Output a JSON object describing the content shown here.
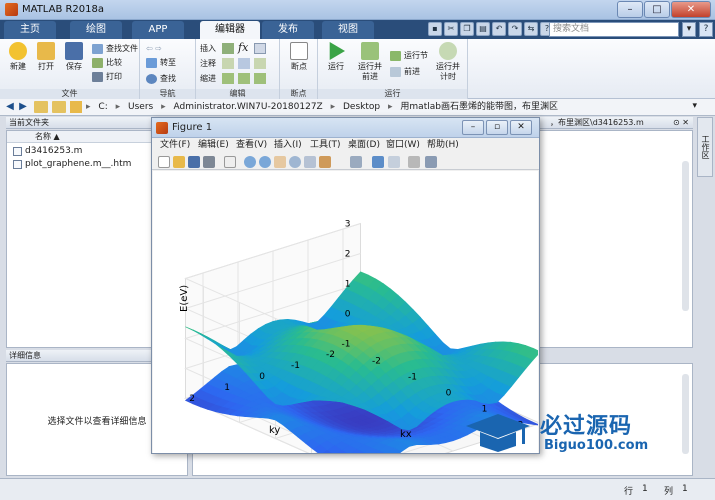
{
  "window": {
    "title": "MATLAB R2018a",
    "min": "–",
    "max": "□",
    "close": "✕"
  },
  "tabs": [
    {
      "label": "主页"
    },
    {
      "label": "绘图"
    },
    {
      "label": "APP"
    },
    {
      "label": "编辑器"
    },
    {
      "label": "发布"
    },
    {
      "label": "视图"
    }
  ],
  "active_tab": "编辑器",
  "search": {
    "placeholder": "搜索文档",
    "go": "▾",
    "help": "?"
  },
  "ribbon": {
    "file": {
      "label": "文件",
      "new": "新建",
      "open": "打开",
      "save": "保存",
      "find_files": "查找文件",
      "compare": "比较",
      "print": "打印"
    },
    "navigate": {
      "label": "导航",
      "goto": "转至",
      "find": "查找"
    },
    "edit": {
      "label": "编辑",
      "insert": "插入",
      "comment": "注释",
      "indent": "缩进"
    },
    "breakpoints": {
      "label": "断点",
      "breakpoints": "断点"
    },
    "run": {
      "label": "运行",
      "run": "运行",
      "run_advance": "运行并\n前进",
      "run_section": "运行节",
      "advance": "前进",
      "run_time": "运行并\n计时"
    }
  },
  "address": {
    "crumbs": [
      "C:",
      "Users",
      "Administrator.WIN7U-20180127Z",
      "Desktop",
      "用matlab画石墨烯的能带图，布里渊区"
    ]
  },
  "current_folder": {
    "title": "当前文件夹",
    "name_header": "名称 ▲",
    "files": [
      "d3416253.m",
      "plot_graphene.m__.htm"
    ]
  },
  "details": {
    "title": "详细信息",
    "empty_text": "选择文件以查看详细信息"
  },
  "editor_tab": "，布里渊区\\d3416253.m",
  "workspace_side": "工作区",
  "figure": {
    "title": "Figure 1",
    "menu": [
      "文件(F)",
      "编辑(E)",
      "查看(V)",
      "插入(I)",
      "工具(T)",
      "桌面(D)",
      "窗口(W)",
      "帮助(H)"
    ]
  },
  "chart_data": {
    "type": "surface",
    "title": "",
    "xlabel": "kx",
    "ylabel": "ky",
    "zlabel": "E(eV)",
    "x_ticks": [
      -2,
      -1,
      0,
      1,
      2
    ],
    "y_ticks": [
      -2,
      -1,
      0,
      1,
      2
    ],
    "z_ticks": [
      -1,
      0,
      1,
      2,
      3
    ],
    "xlim": [
      -2.5,
      2.5
    ],
    "ylim": [
      -2.5,
      2.5
    ],
    "zlim": [
      -1,
      3
    ],
    "colormap": "parula",
    "surfaces": [
      "upper band",
      "lower band"
    ]
  },
  "status": {
    "line_label": "行",
    "line": "1",
    "col_label": "列",
    "col": "1"
  },
  "watermark": {
    "cn": "必过源码",
    "en": "Biguo100.com"
  }
}
